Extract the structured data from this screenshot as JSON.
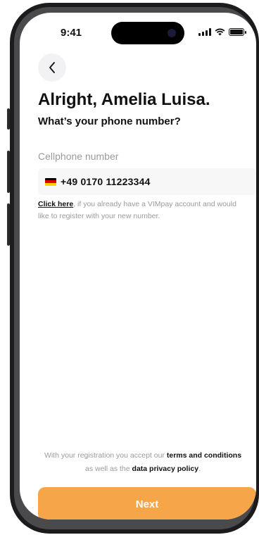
{
  "status_bar": {
    "time": "9:41",
    "icons": [
      "signal-icon",
      "wifi-icon",
      "battery-icon"
    ]
  },
  "nav": {
    "back_icon": "chevron-left-icon"
  },
  "header": {
    "title": "Alright, Amelia Luisa.",
    "subtitle": "What’s your phone number?"
  },
  "phone": {
    "label": "Cellphone number",
    "flag": "germany-flag-icon",
    "value": "+49 0170 11223344"
  },
  "hint": {
    "link_text": "Click here",
    "text": ", if you already have a VIMpay account and would like to register with your new number."
  },
  "legal": {
    "prefix": "With your registration you accept our ",
    "terms_link": "terms and conditions",
    "middle": " as well as the ",
    "privacy_link": "data privacy policy",
    "suffix": "."
  },
  "actions": {
    "next_label": "Next"
  },
  "colors": {
    "accent": "#f6a548",
    "muted_text": "#9a9aa0",
    "field_bg": "#f7f7f8"
  }
}
